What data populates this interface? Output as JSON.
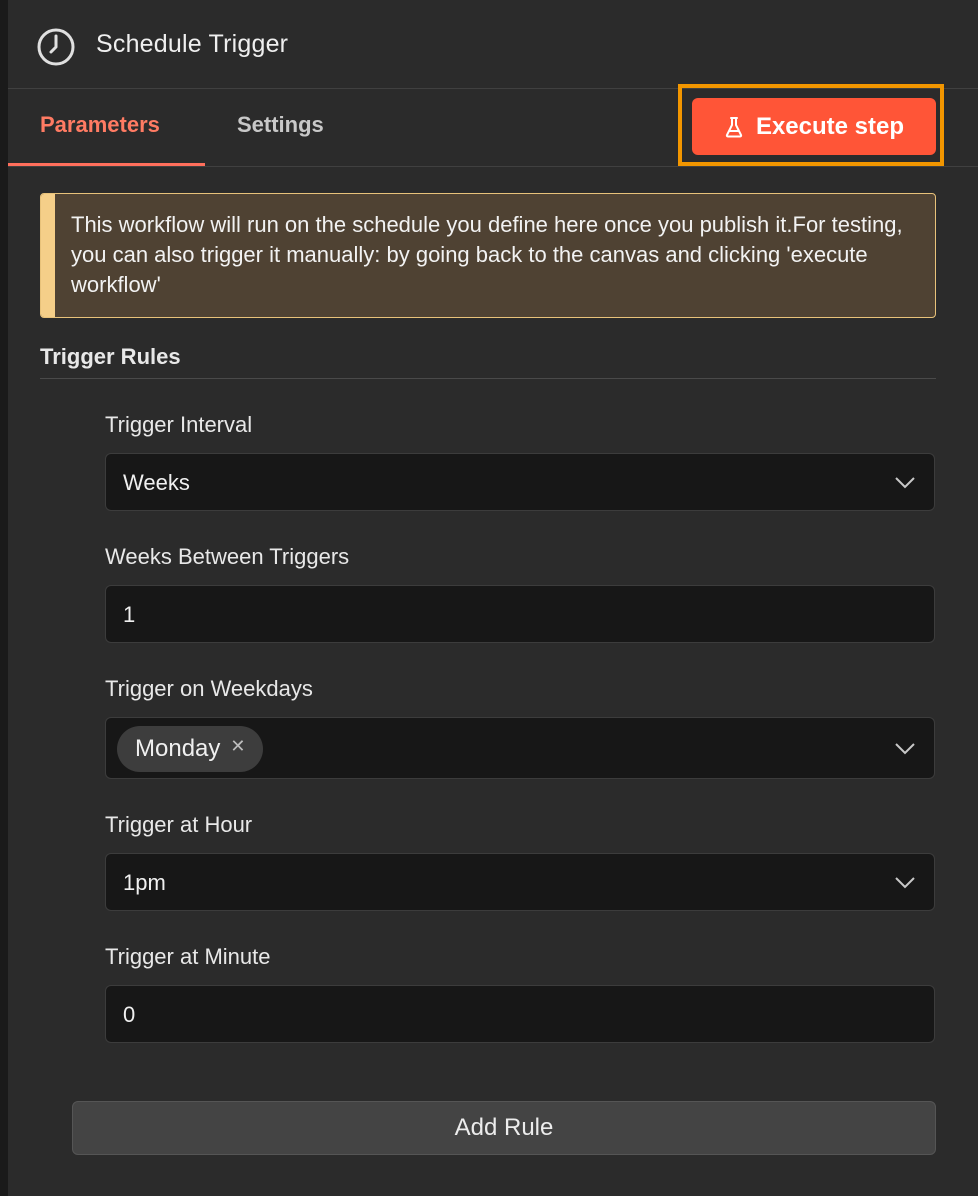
{
  "header": {
    "title": "Schedule Trigger",
    "icon": "clock-icon"
  },
  "tabs": [
    {
      "label": "Parameters",
      "active": true
    },
    {
      "label": "Settings",
      "active": false
    }
  ],
  "execute_button": {
    "label": "Execute step",
    "icon": "flask-icon",
    "color": "#ff5537",
    "highlight_color": "#f29600"
  },
  "notice": {
    "text": "This workflow will run on the schedule you define here once you publish it.For testing, you can also trigger it manually: by going back to the canvas and clicking 'execute workflow'"
  },
  "section": {
    "title": "Trigger Rules"
  },
  "fields": {
    "interval": {
      "label": "Trigger Interval",
      "value": "Weeks"
    },
    "weeks_between": {
      "label": "Weeks Between Triggers",
      "value": "1"
    },
    "weekdays": {
      "label": "Trigger on Weekdays",
      "chips": [
        "Monday"
      ]
    },
    "hour": {
      "label": "Trigger at Hour",
      "value": "1pm"
    },
    "minute": {
      "label": "Trigger at Minute",
      "value": "0"
    }
  },
  "add_rule": {
    "label": "Add Rule"
  },
  "colors": {
    "accent": "#ff6f5c",
    "panel_bg": "#2b2b2b",
    "input_bg": "#171717"
  }
}
